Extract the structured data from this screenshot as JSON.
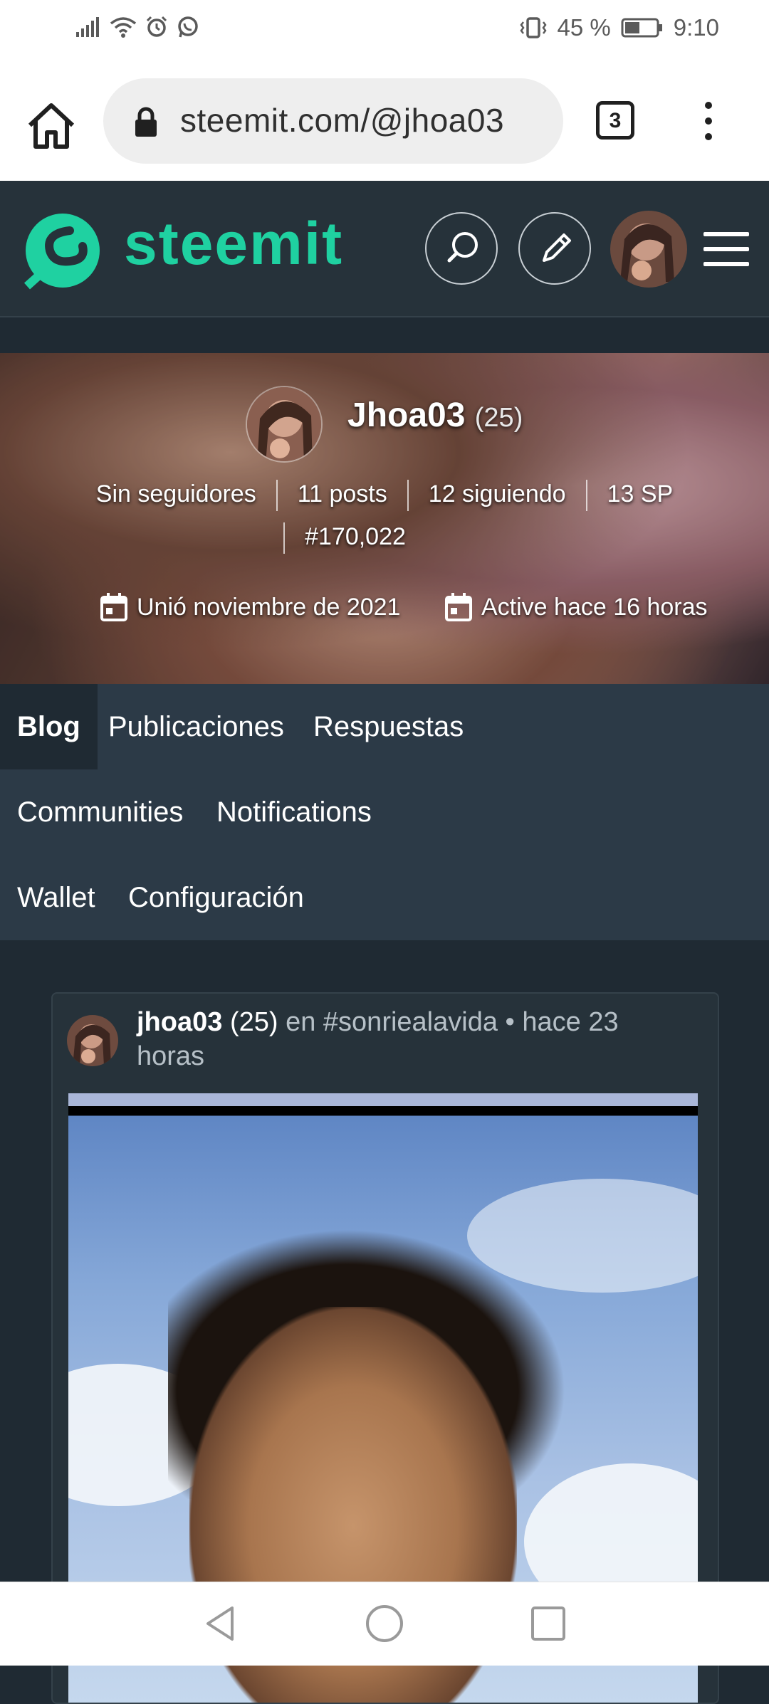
{
  "status_bar": {
    "battery": "45 %",
    "time": "9:10"
  },
  "browser": {
    "url": "steemit.com/@jhoa03",
    "tab_count": "3"
  },
  "header": {
    "logo_text": "steemit",
    "brand_color": "#1fd1a1"
  },
  "profile": {
    "name": "Jhoa03",
    "reputation": "(25)",
    "followers": "Sin seguidores",
    "posts": "11 posts",
    "following": "12 siguiendo",
    "sp": "13 SP",
    "rank": "#170,022",
    "joined": "Unió noviembre de 2021",
    "active": "Active hace 16 horas"
  },
  "nav": {
    "tabs": [
      "Blog",
      "Publicaciones",
      "Respuestas",
      "Communities",
      "Notifications",
      "Wallet",
      "Configuración"
    ],
    "active": "Blog"
  },
  "post": {
    "author": "jhoa03",
    "reputation": "(25)",
    "community": "en #sonriealavida",
    "time": "• hace 23 horas"
  }
}
